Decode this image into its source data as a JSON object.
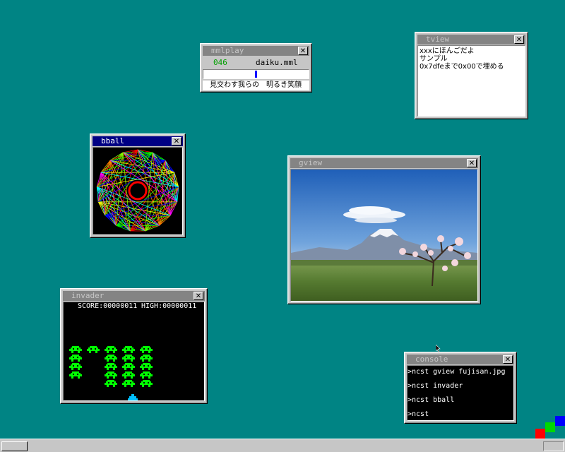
{
  "windows": {
    "mmlplay": {
      "title": "mmlplay",
      "counter": "046",
      "filename": "daiku.mml",
      "lyric": "見交わす我らの　明るき笑顔",
      "progress": 0.5
    },
    "tview": {
      "title": "tview",
      "lines": [
        "xxxにほんごだよ",
        "サンプル",
        "0x7dfeまで0x00で埋める"
      ]
    },
    "bball": {
      "title": "bball"
    },
    "gview": {
      "title": "gview"
    },
    "invader": {
      "title": "invader",
      "score_label": "SCORE:00000011",
      "high_label": "HIGH:00000011"
    },
    "console": {
      "title": "console",
      "lines": [
        ">ncst gview fujisan.jpg",
        ">ncst invader",
        ">ncst bball",
        ">ncst"
      ]
    }
  },
  "icons": {
    "close": "close-icon",
    "start": "start-button",
    "logo": "color-cubes-logo"
  },
  "colors": {
    "desktop": "#008484",
    "active_title": "#000084",
    "inactive_title": "#848484",
    "counter_green": "#00a000",
    "invader_green": "#00ff00",
    "player_cyan": "#00c0ff",
    "progress_blue": "#0000ff"
  }
}
